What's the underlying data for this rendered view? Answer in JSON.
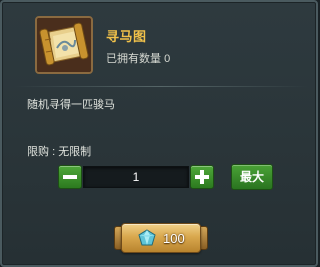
{
  "item": {
    "name": "寻马图",
    "owned_label": "已拥有数量",
    "owned_count": "0",
    "description": "随机寻得一匹骏马",
    "icon": "scroll-map-icon"
  },
  "purchase": {
    "limit_label": "限购",
    "limit_separator": ":",
    "limit_value": "无限制",
    "quantity": "1",
    "max_label": "最大",
    "price": "100",
    "currency_icon": "gem-icon"
  },
  "colors": {
    "title_gold": "#f2c24a",
    "button_green": "#3e922e",
    "buy_gold": "#d9a84e"
  }
}
